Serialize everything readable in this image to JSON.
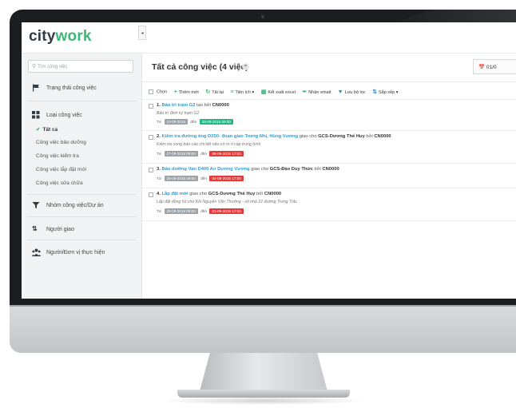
{
  "app": {
    "logo_left": "city",
    "logo_right": "work"
  },
  "sidebar": {
    "search_placeholder": "Tìm công việc",
    "collapse_glyph": "◂",
    "sections": {
      "status": "Trạng thái công việc",
      "type": "Loại công việc",
      "group": "Nhóm công việc/Dự án",
      "assigner": "Người giao",
      "assignee": "Người/Đơn vị thực hiện"
    },
    "types": {
      "all": "Tất cả",
      "maintenance": "Công việc bảo dưỡng",
      "inspection": "Công việc kiểm tra",
      "installation": "Công việc lắp đặt mới",
      "repair": "Công việc sửa chữa"
    },
    "check_glyph": "✔"
  },
  "main": {
    "title": "Tất cả công việc (4 việc)",
    "title_caret": "▾",
    "date_label": "01/0",
    "toolbar": {
      "select": "Chọn",
      "add": "Thêm mới",
      "reload": "Tải lại",
      "utilities": "Tiện ích",
      "export": "Kết xuất excel",
      "email": "Nhận email",
      "save_filter": "Lưu bộ lọc",
      "sort": "Sắp xếp"
    },
    "tasks": [
      {
        "num": "1.",
        "name": "Bảo trì trạm G2",
        "by_text": "tạo bởi",
        "creator": "CN0000",
        "desc": "Bảo trì định kỳ trạm G2",
        "from_label": "Từ",
        "from": "10-09-2015",
        "to_label": "đến",
        "to": "28-09-2015 09:00",
        "to_status": "green"
      },
      {
        "num": "2.",
        "name": "Kiểm tra đường ống D250- đoạn giao Trưng Nhị, Hùng Vương",
        "assign_text": "giao cho",
        "assignee": "GCS-Dương Thế Huy",
        "by_text": "bởi",
        "creator": "CN0000",
        "desc": "Kiểm tra xong báo cáo chi tiết nếu có rò rỉ cấp trung bình",
        "from_label": "Từ",
        "from": "27-08-2015 09:00",
        "to_label": "đến",
        "to": "05-09-2015 17:00",
        "to_status": "red"
      },
      {
        "num": "3.",
        "name": "Bảo dưỡng Van D400 An Dương Vương",
        "assign_text": "giao cho",
        "assignee": "GCS-Đào Duy Thức",
        "by_text": "bởi",
        "creator": "CN0000",
        "from_label": "Từ",
        "from": "28-08-2015 09:00",
        "to_label": "đến",
        "to": "04-09-2015 17:00",
        "to_status": "red"
      },
      {
        "num": "4.",
        "name": "Lắp đặt mới",
        "assign_text": "giao cho",
        "assignee": "GCS-Dương Thế Huy",
        "by_text": "bởi",
        "creator": "CN0000",
        "desc": "Lắp đặt đồng hồ cho KH Nguyễn Văn Thưởng - số nhà 22 đường Trưng Trắc",
        "from_label": "Từ",
        "from": "29-08-2015 09:00",
        "to_label": "đến",
        "to": "01-09-2015 17:00",
        "to_status": "red"
      }
    ]
  },
  "colors": {
    "accent": "#3cb878",
    "link": "#2a9fd6",
    "overdue": "#e23b3b",
    "ontime": "#27b88a",
    "neutral": "#9ea3a8"
  }
}
